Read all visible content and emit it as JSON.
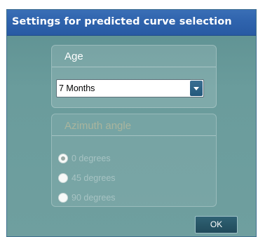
{
  "dialog": {
    "title": "Settings for predicted curve selection"
  },
  "age": {
    "heading": "Age",
    "selected": "7 Months"
  },
  "azimuth": {
    "heading": "Azimuth angle",
    "options": [
      "0 degrees",
      "45 degrees",
      "90 degrees"
    ],
    "selected_index": 0,
    "enabled": false
  },
  "buttons": {
    "ok_label": "OK"
  }
}
